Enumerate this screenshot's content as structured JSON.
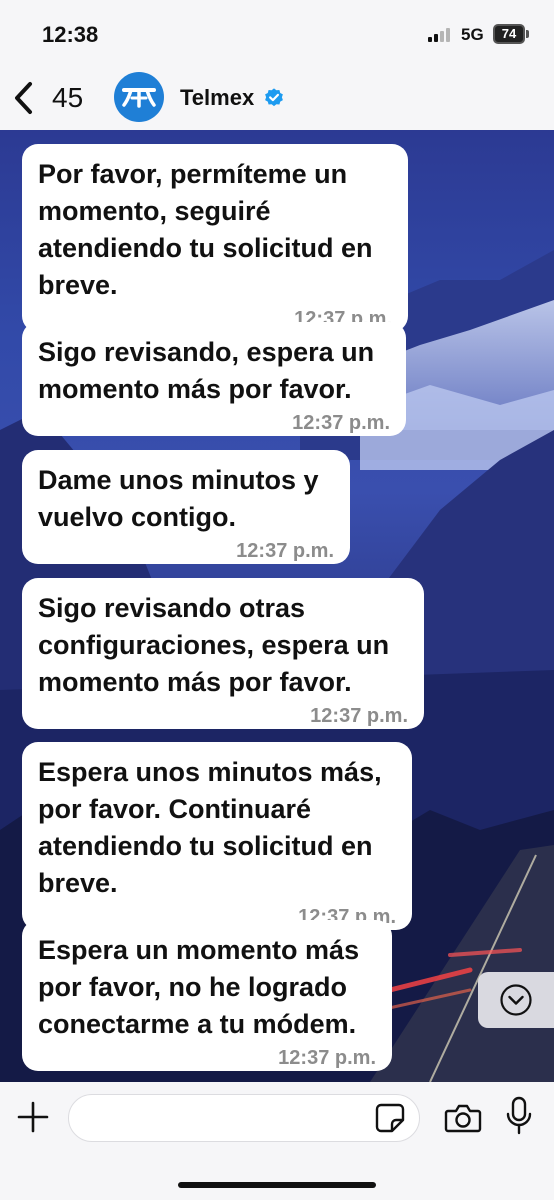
{
  "status_bar": {
    "time": "12:38",
    "network": "5G",
    "battery": "74",
    "signal_icon": "signal-bars-icon"
  },
  "header": {
    "back_count": "45",
    "contact_name": "Telmex",
    "verified_icon": "verified-badge-icon",
    "accent_color": "#1f7fd6"
  },
  "messages": [
    {
      "text": "Por favor, permíteme un momento, seguiré atendiendo tu solicitud en breve.",
      "time": "12:37 p.m."
    },
    {
      "text": "Sigo revisando, espera un momento más por favor.",
      "time": "12:37 p.m."
    },
    {
      "text": "Dame unos minutos y vuelvo contigo.",
      "time": "12:37 p.m."
    },
    {
      "text": "Sigo revisando otras configuraciones, espera un momento más por favor.",
      "time": "12:37 p.m."
    },
    {
      "text": "Espera unos minutos más, por favor. Continuaré atendiendo tu solicitud en breve.",
      "time": "12:37 p.m."
    },
    {
      "text": "Espera un momento más por favor, no he logrado conectarme a tu módem.",
      "time": "12:37 p.m."
    }
  ],
  "input_bar": {
    "placeholder": "",
    "icons": [
      "plus-icon",
      "sticker-icon",
      "camera-icon",
      "microphone-icon"
    ]
  },
  "scroll_button_icon": "chevron-down-icon"
}
